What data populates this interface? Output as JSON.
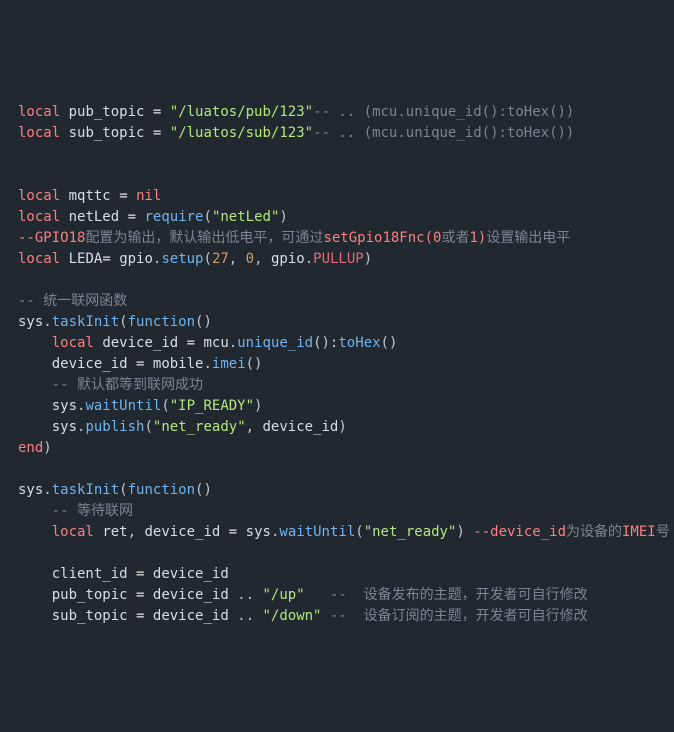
{
  "l1": {
    "kw": "local",
    "var": "pub_topic",
    "eq": "=",
    "str": "\"/luatos/pub/123\"",
    "cmt": "-- .. (mcu.unique_id():toHex())"
  },
  "l2": {
    "kw": "local",
    "var": "sub_topic",
    "eq": "=",
    "str": "\"/luatos/sub/123\"",
    "cmt": "-- .. (mcu.unique_id():toHex())"
  },
  "l4": {
    "kw": "local",
    "var": "mqttc",
    "eq": "=",
    "nil": "nil"
  },
  "l5": {
    "kw": "local",
    "var": "netLed",
    "eq": "=",
    "fn": "require",
    "open": "(",
    "str": "\"netLed\"",
    "close": ")"
  },
  "l6": {
    "a": "--GPIO18",
    "b": "配置为输出，默认输出低电平，可通过",
    "c": "setGpio18Fnc(0",
    "d": "或者",
    "e": "1)",
    "f": "设置输出电平"
  },
  "l7": {
    "kw": "local",
    "var": "LEDA",
    "eq": "=",
    "mod": "gpio",
    "dot": ".",
    "fn": "setup",
    "open": "(",
    "n1": "27",
    "c1": ",",
    "n2": "0",
    "c2": ",",
    "mod2": "gpio",
    "dot2": ".",
    "const": "PULLUP",
    "close": ")"
  },
  "l9": {
    "cmt": "-- 统一联网函数"
  },
  "l10": {
    "mod": "sys",
    "dot": ".",
    "fn": "taskInit",
    "open": "(",
    "kw": "function",
    "args": "()"
  },
  "l11": {
    "kw": "local",
    "var": "device_id",
    "eq": "=",
    "mod": "mcu",
    "dot": ".",
    "fn1": "unique_id",
    "p1": "():",
    "fn2": "toHex",
    "p2": "()"
  },
  "l12": {
    "var": "device_id",
    "eq": "=",
    "mod": "mobile",
    "dot": ".",
    "fn": "imei",
    "p": "()"
  },
  "l13": {
    "cmt": "-- 默认都等到联网成功"
  },
  "l14": {
    "mod": "sys",
    "dot": ".",
    "fn": "waitUntil",
    "open": "(",
    "str": "\"IP_READY\"",
    "close": ")"
  },
  "l15": {
    "mod": "sys",
    "dot": ".",
    "fn": "publish",
    "open": "(",
    "str": "\"net_ready\"",
    "c": ",",
    "var": "device_id",
    "close": ")"
  },
  "l16": {
    "kw": "end",
    "p": ")"
  },
  "l18": {
    "mod": "sys",
    "dot": ".",
    "fn": "taskInit",
    "open": "(",
    "kw": "function",
    "args": "()"
  },
  "l19": {
    "cmt": "-- 等待联网"
  },
  "l20": {
    "kw": "local",
    "v1": "ret",
    "c": ",",
    "v2": "device_id",
    "eq": "=",
    "mod": "sys",
    "dot": ".",
    "fn": "waitUntil",
    "open": "(",
    "str": "\"net_ready\"",
    "close": ")",
    "cmt1": "--device_id",
    "cmt2": "为设备的",
    "cmt3": "IMEI",
    "cmt4": "号"
  },
  "l22": {
    "v1": "client_id",
    "eq": "=",
    "v2": "device_id"
  },
  "l23": {
    "v1": "pub_topic",
    "eq": "=",
    "v2": "device_id",
    "cc": "..",
    "str": "\"/up\"",
    "cmt": "--  设备发布的主题，开发者可自行修改"
  },
  "l24": {
    "v1": "sub_topic",
    "eq": "=",
    "v2": "device_id",
    "cc": "..",
    "str": "\"/down\"",
    "cmt": "--  设备订阅的主题，开发者可自行修改"
  }
}
